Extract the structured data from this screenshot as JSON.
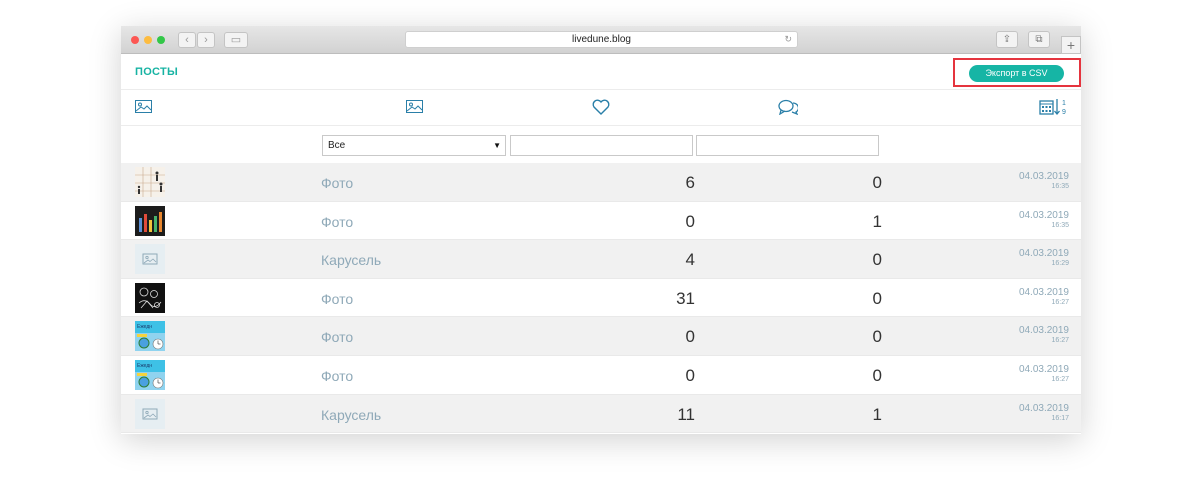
{
  "browser": {
    "url": "livedune.blog"
  },
  "header": {
    "title": "ПОСТЫ",
    "export_label": "Экспорт в CSV"
  },
  "filters": {
    "type_selected": "Все"
  },
  "colors": {
    "accent": "#16b5a5",
    "highlight": "#e5343e",
    "muted_text": "#8fa9b8",
    "icon": "#2a7fa8"
  },
  "icons": {
    "col1": "image-icon",
    "col2": "image-icon",
    "col3": "heart-icon",
    "col4": "comments-icon",
    "col5": "calendar-sort-icon"
  },
  "rows": [
    {
      "thumb": "photo-grid",
      "type": "Фото",
      "likes": "6",
      "comments": "0",
      "date": "04.03.2019",
      "time": "16:35"
    },
    {
      "thumb": "dark-chart",
      "type": "Фото",
      "likes": "0",
      "comments": "1",
      "date": "04.03.2019",
      "time": "16:35"
    },
    {
      "thumb": "placeholder",
      "type": "Карусель",
      "likes": "4",
      "comments": "0",
      "date": "04.03.2019",
      "time": "16:29"
    },
    {
      "thumb": "dark-sketch",
      "type": "Фото",
      "likes": "31",
      "comments": "0",
      "date": "04.03.2019",
      "time": "16:27"
    },
    {
      "thumb": "colorful",
      "type": "Фото",
      "likes": "0",
      "comments": "0",
      "date": "04.03.2019",
      "time": "16:27"
    },
    {
      "thumb": "colorful",
      "type": "Фото",
      "likes": "0",
      "comments": "0",
      "date": "04.03.2019",
      "time": "16:27"
    },
    {
      "thumb": "placeholder",
      "type": "Карусель",
      "likes": "11",
      "comments": "1",
      "date": "04.03.2019",
      "time": "16:17"
    }
  ]
}
